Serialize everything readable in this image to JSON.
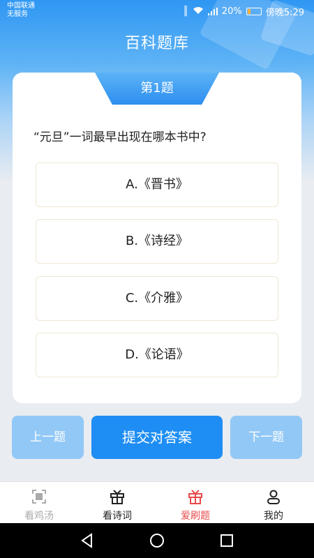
{
  "status_bar": {
    "carrier_line1": "中国联通",
    "carrier_line2": "无服务",
    "battery": "20%",
    "time": "傍晚5:29"
  },
  "header": {
    "title": "百科题库"
  },
  "quiz": {
    "question_number": "第1题",
    "question": "“元旦”一词最早出现在哪本书中?",
    "options": [
      "A.《晋书》",
      "B.《诗经》",
      "C.《介雅》",
      "D.《论语》"
    ]
  },
  "actions": {
    "prev_label": "上一题",
    "submit_label": "提交对答案",
    "next_label": "下一题"
  },
  "tabbar": {
    "items": [
      {
        "label": "看鸡汤",
        "icon": "scan-frame-icon",
        "color": "#aaaaaa"
      },
      {
        "label": "看诗词",
        "icon": "gift-box-icon",
        "color": "#222222"
      },
      {
        "label": "爱刷题",
        "icon": "gift-box-icon",
        "color": "#e84a4a"
      },
      {
        "label": "我的",
        "icon": "person-icon",
        "color": "#222222"
      }
    ]
  },
  "colors": {
    "accent": "#1e8ef4",
    "disabled_button": "#92c8f6",
    "active_tab": "#e84a4a"
  }
}
